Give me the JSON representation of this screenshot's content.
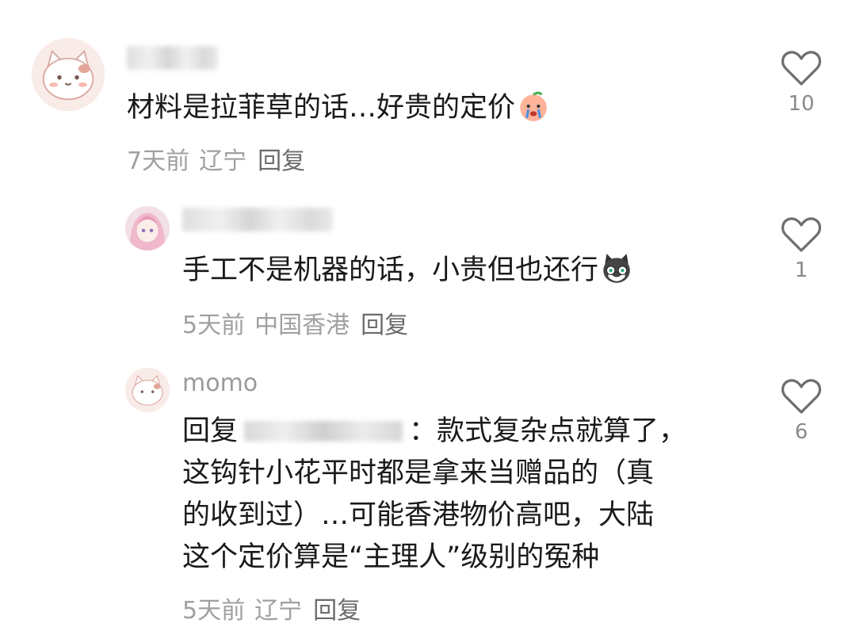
{
  "comments": [
    {
      "username": "",
      "text_lines": [
        "材料是拉菲草的话…好贵的定价"
      ],
      "emoji": "crying-peach-emoji",
      "time": "7天前",
      "location": "辽宁",
      "reply_label": "回复",
      "likes": "10"
    },
    {
      "username": "",
      "text_lines": [
        "手工不是机器的话，小贵但也还行"
      ],
      "emoji": "cat-face-emoji",
      "time": "5天前",
      "location": "中国香港",
      "reply_label": "回复",
      "likes": "1"
    },
    {
      "username": "momo",
      "reply_prefix": "回复",
      "text_first_rest": "：款式复杂点就算了，",
      "text_lines": [
        "这钩针小花平时都是拿来当赠品的（真",
        "的收到过）…可能香港物价高吧，大陆",
        "这个定价算是“主理人”级别的冤种"
      ],
      "time": "5天前",
      "location": "辽宁",
      "reply_label": "回复",
      "likes": "6"
    }
  ]
}
